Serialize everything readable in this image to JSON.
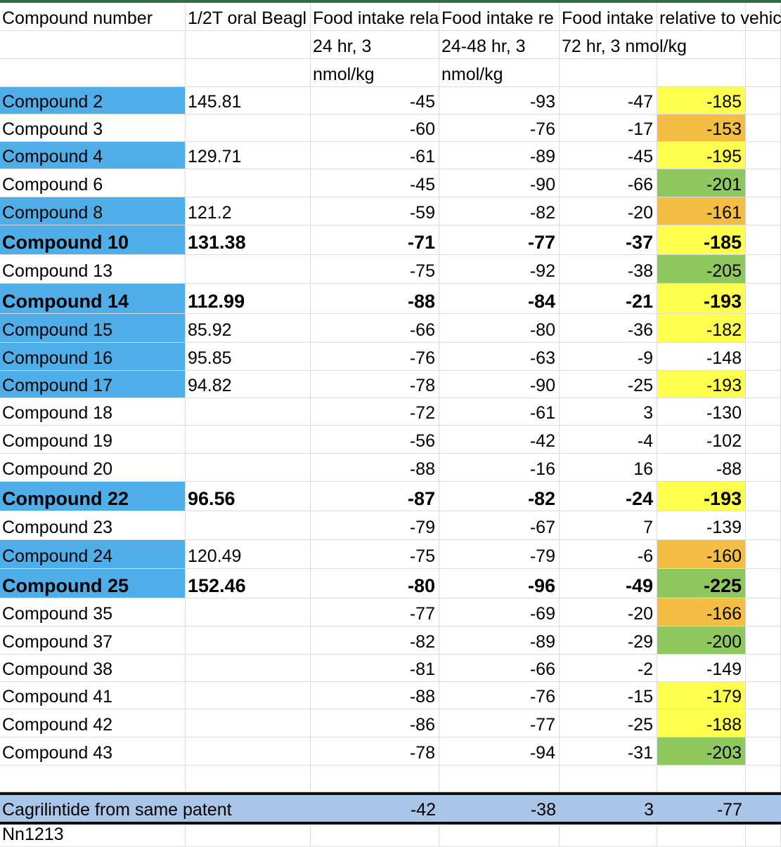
{
  "headers": [
    [
      "Compound number",
      "1/2T oral Beagl",
      "Food intake rela",
      "Food intake re",
      "Food intake",
      "relative to vehic"
    ],
    [
      "",
      "",
      "24 hr, 3",
      "24-48 hr, 3",
      "72 hr, 3 nmol/kg",
      ""
    ],
    [
      "",
      "",
      "nmol/kg",
      "nmol/kg",
      "",
      ""
    ]
  ],
  "rows": [
    {
      "cells": [
        "Compound 2",
        "145.81",
        "-45",
        "-93",
        "-47",
        "-185"
      ],
      "bold": false,
      "blue": true,
      "color": "yellow"
    },
    {
      "cells": [
        "Compound 3",
        "",
        "-60",
        "-76",
        "-17",
        "-153"
      ],
      "bold": false,
      "blue": false,
      "color": "orange"
    },
    {
      "cells": [
        "Compound 4",
        "129.71",
        "-61",
        "-89",
        "-45",
        "-195"
      ],
      "bold": false,
      "blue": true,
      "color": "yellow"
    },
    {
      "cells": [
        "Compound 6",
        "",
        "-45",
        "-90",
        "-66",
        "-201"
      ],
      "bold": false,
      "blue": false,
      "color": "green"
    },
    {
      "cells": [
        "Compound 8",
        "121.2",
        "-59",
        "-82",
        "-20",
        "-161"
      ],
      "bold": false,
      "blue": true,
      "color": "orange"
    },
    {
      "cells": [
        "Compound 10",
        "131.38",
        "-71",
        "-77",
        "-37",
        "-185"
      ],
      "bold": true,
      "blue": true,
      "color": "yellow"
    },
    {
      "cells": [
        "Compound 13",
        "",
        "-75",
        "-92",
        "-38",
        "-205"
      ],
      "bold": false,
      "blue": false,
      "color": "green"
    },
    {
      "cells": [
        "Compound 14",
        "112.99",
        "-88",
        "-84",
        "-21",
        "-193"
      ],
      "bold": true,
      "blue": true,
      "color": "yellow"
    },
    {
      "cells": [
        "Compound 15",
        "85.92",
        "-66",
        "-80",
        "-36",
        "-182"
      ],
      "bold": false,
      "blue": true,
      "color": "yellow"
    },
    {
      "cells": [
        "Compound 16",
        "95.85",
        "-76",
        "-63",
        "-9",
        "-148"
      ],
      "bold": false,
      "blue": true,
      "color": ""
    },
    {
      "cells": [
        "Compound 17",
        "94.82",
        "-78",
        "-90",
        "-25",
        "-193"
      ],
      "bold": false,
      "blue": true,
      "color": "yellow"
    },
    {
      "cells": [
        "Compound 18",
        "",
        "-72",
        "-61",
        "3",
        "-130"
      ],
      "bold": false,
      "blue": false,
      "color": ""
    },
    {
      "cells": [
        "Compound 19",
        "",
        "-56",
        "-42",
        "-4",
        "-102"
      ],
      "bold": false,
      "blue": false,
      "color": ""
    },
    {
      "cells": [
        "Compound 20",
        "",
        "-88",
        "-16",
        "16",
        "-88"
      ],
      "bold": false,
      "blue": false,
      "color": ""
    },
    {
      "cells": [
        "Compound 22",
        "96.56",
        "-87",
        "-82",
        "-24",
        "-193"
      ],
      "bold": true,
      "blue": true,
      "color": "yellow"
    },
    {
      "cells": [
        "Compound 23",
        "",
        "-79",
        "-67",
        "7",
        "-139"
      ],
      "bold": false,
      "blue": false,
      "color": ""
    },
    {
      "cells": [
        "Compound 24",
        "120.49",
        "-75",
        "-79",
        "-6",
        "-160"
      ],
      "bold": false,
      "blue": true,
      "color": "orange"
    },
    {
      "cells": [
        "Compound 25",
        "152.46",
        "-80",
        "-96",
        "-49",
        "-225"
      ],
      "bold": true,
      "blue": true,
      "color": "green"
    },
    {
      "cells": [
        "Compound 35",
        "",
        "-77",
        "-69",
        "-20",
        "-166"
      ],
      "bold": false,
      "blue": false,
      "color": "orange"
    },
    {
      "cells": [
        "Compound 37",
        "",
        "-82",
        "-89",
        "-29",
        "-200"
      ],
      "bold": false,
      "blue": false,
      "color": "green"
    },
    {
      "cells": [
        "Compound 38",
        "",
        "-81",
        "-66",
        "-2",
        "-149"
      ],
      "bold": false,
      "blue": false,
      "color": ""
    },
    {
      "cells": [
        "Compound 41",
        "",
        "-88",
        "-76",
        "-15",
        "-179"
      ],
      "bold": false,
      "blue": false,
      "color": "yellow"
    },
    {
      "cells": [
        "Compound 42",
        "",
        "-86",
        "-77",
        "-25",
        "-188"
      ],
      "bold": false,
      "blue": false,
      "color": "yellow"
    },
    {
      "cells": [
        "Compound 43",
        "",
        "-78",
        "-94",
        "-31",
        "-203"
      ],
      "bold": false,
      "blue": false,
      "color": "green"
    }
  ],
  "cagrilintide": {
    "label": "Cagrilintide from same patent",
    "values": [
      "-42",
      "-38",
      "3",
      "-77"
    ]
  },
  "footer": {
    "label": "Nn1213"
  },
  "colors": {
    "blue": "#4fade8",
    "yellow": "#ffff4d",
    "orange": "#f4bd43",
    "green": "#8ec85e",
    "cagrilintide_row": "#a9c5e8"
  }
}
